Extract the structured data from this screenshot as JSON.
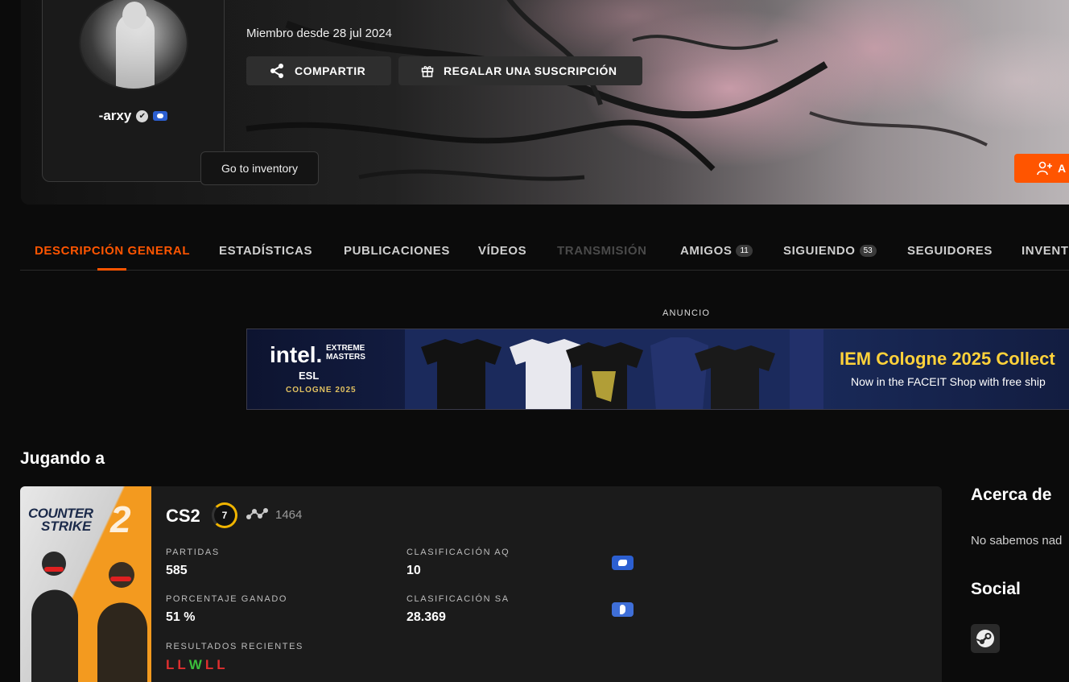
{
  "profile": {
    "username": "-arxy",
    "member_since": "Miembro desde 28 jul 2024",
    "verified_glyph": "✔"
  },
  "actions": {
    "share_label": "COMPARTIR",
    "gift_label": "REGALAR UNA SUSCRIPCIÓN",
    "add_label": "A"
  },
  "tooltip": {
    "text": "Go to inventory"
  },
  "tabs": [
    {
      "label": "DESCRIPCIÓN GENERAL",
      "state": "active"
    },
    {
      "label": "ESTADÍSTICAS"
    },
    {
      "label": "PUBLICACIONES"
    },
    {
      "label": "VÍDEOS"
    },
    {
      "label": "TRANSMISIÓN",
      "state": "disabled"
    },
    {
      "label": "AMIGOS",
      "count": "11"
    },
    {
      "label": "SIGUIENDO",
      "count": "53"
    },
    {
      "label": "SEGUIDORES"
    },
    {
      "label": "INVENT"
    }
  ],
  "ad": {
    "label": "ANUNCIO",
    "logo_main": "intel.",
    "logo_line1": "EXTREME",
    "logo_line2": "MASTERS",
    "logo_esl": "ESL",
    "logo_city": "COLOGNE 2025",
    "headline": "IEM Cologne 2025 Collect",
    "subline": "Now in the FACEIT Shop with free ship"
  },
  "playing": {
    "title": "Jugando a",
    "game": {
      "art_line1": "COUNTER",
      "art_line2": "STRIKE",
      "art_number": "2",
      "name": "CS2",
      "level": "7",
      "elo": "1464",
      "matches_label": "PARTIDAS",
      "matches_value": "585",
      "winrate_label": "PORCENTAJE GANADO",
      "winrate_value": "51 %",
      "region_rank_label": "CLASIFICACIÓN AQ",
      "region_rank_value": "10",
      "country_rank_label": "CLASIFICACIÓN SA",
      "country_rank_value": "28.369",
      "recent_label": "RESULTADOS RECIENTES",
      "recent_results": [
        "L",
        "L",
        "W",
        "L",
        "L"
      ]
    }
  },
  "about": {
    "title": "Acerca de",
    "text": "No sabemos nad"
  },
  "social": {
    "title": "Social",
    "steam_icon": "steam-icon"
  },
  "colors": {
    "accent": "#ff5500",
    "loss": "#e02f2f",
    "win": "#3bbf3b",
    "level": "#f0b400"
  }
}
